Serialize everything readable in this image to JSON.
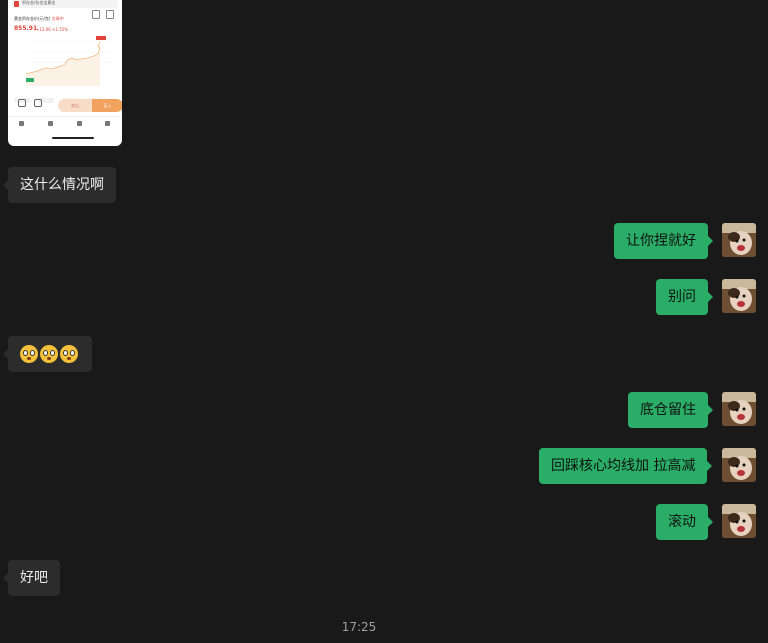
{
  "shared_image": {
    "header_text": "积存金/存金宝黄金",
    "name": "黄金积存金价(元/克)",
    "tag": "交易中",
    "price": "855.91",
    "change": "+13.06  +1.55%",
    "btn_sell": "卖出",
    "btn_buy": "买入"
  },
  "messages": [
    {
      "side": "left",
      "text": "这什么情况啊"
    },
    {
      "side": "right",
      "text": "让你捏就好"
    },
    {
      "side": "right",
      "text": "别问"
    },
    {
      "side": "left",
      "emoji": "worried-face-emoji x3"
    },
    {
      "side": "right",
      "text": "底仓留住"
    },
    {
      "side": "right",
      "text": "回踩核心均线加 拉高减"
    },
    {
      "side": "right",
      "text": "滚动"
    },
    {
      "side": "left",
      "text": "好吧"
    }
  ],
  "timestamp": "17:25",
  "colors": {
    "bg": "#191919",
    "left_bubble": "#2c2c2c",
    "right_bubble": "#2aae67",
    "chart_line": "#f0a25e",
    "price_red": "#e0443a"
  }
}
